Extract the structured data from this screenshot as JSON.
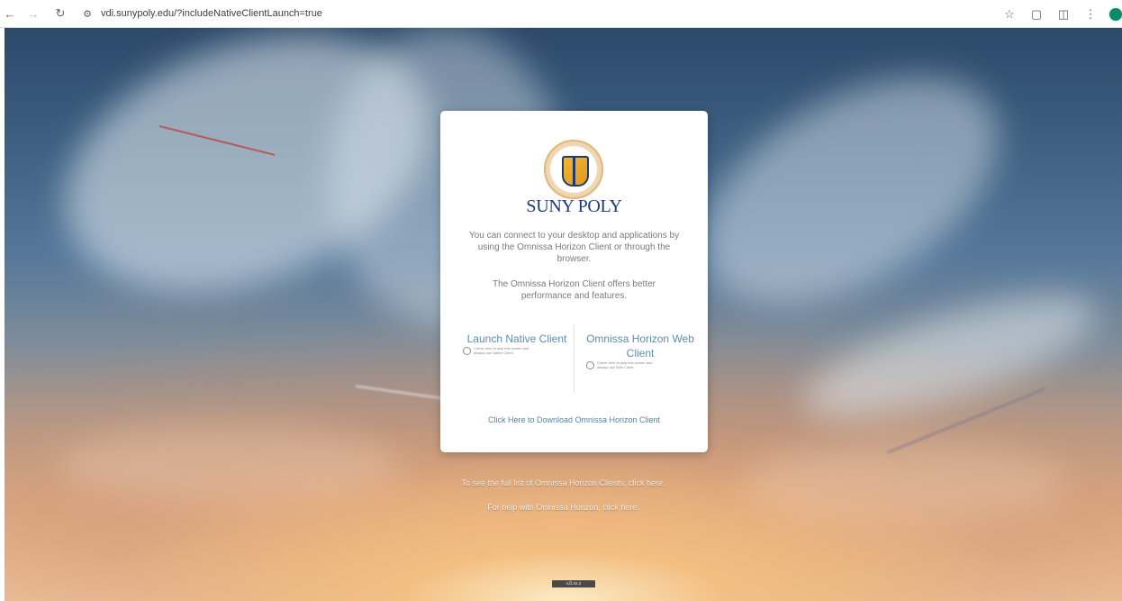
{
  "browser": {
    "url": "vdi.sunypoly.edu/?includeNativeClientLaunch=true",
    "back_icon": "back-arrow-icon",
    "forward_icon": "forward-arrow-icon",
    "reload_icon": "reload-icon",
    "site_info_icon": "site-settings-icon",
    "bookmark_icon": "star-icon",
    "extension_icon": "puzzle-icon",
    "sidebar_icon": "split-screen-icon",
    "menu_icon": "kebab-menu-icon",
    "profile_color": "#0b8a6a"
  },
  "card": {
    "logo": "suny-poly-seal",
    "brand_name": "SUNY POLY",
    "intro_text": "You can connect to your desktop and applications by using the Omnissa Horizon Client or through the browser.",
    "performance_text": "The Omnissa Horizon Client offers better performance and features.",
    "options": [
      {
        "title": "Launch Native Client",
        "note": "Check here to skip this screen and always use Native Client."
      },
      {
        "title": "Omnissa Horizon Web Client",
        "note": "Check here to skip this screen and always use Web Client."
      }
    ],
    "download_link": "Click Here to Download Omnissa Horizon Client"
  },
  "footer": {
    "full_list_link": "To see the full list of Omnissa Horizon Clients, click here.",
    "help_link": "For help with Omnissa Horizon, click here.",
    "version_badge": "v.8.xx.x"
  },
  "colors": {
    "brand_blue": "#1d3a7a",
    "link_blue": "#4f86a8",
    "option_blue": "#5a8fb0"
  }
}
